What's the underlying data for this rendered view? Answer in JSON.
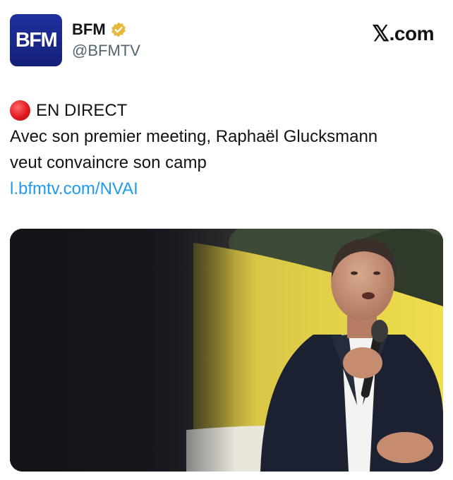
{
  "author": {
    "avatar_text": "BFM",
    "name": "BFM",
    "handle": "@BFMTV",
    "verified_icon": "verified-gold-badge-icon"
  },
  "brand": {
    "x_glyph": "𝕏",
    "suffix": ".com"
  },
  "tweet": {
    "live_icon": "red-circle-emoji-icon",
    "live_label": "EN DIRECT",
    "line1": "Avec son premier meeting, Raphaël Glucksmann",
    "line2": "veut convaincre son camp",
    "link": "l.bfmtv.com/NVAI"
  },
  "media": {
    "kind": "photo"
  },
  "colors": {
    "avatar_bg": "#1f2f9e",
    "verified": "#e8b83a",
    "link": "#1d9bf0",
    "live_dot": "#e0191f",
    "handle": "#536471"
  }
}
